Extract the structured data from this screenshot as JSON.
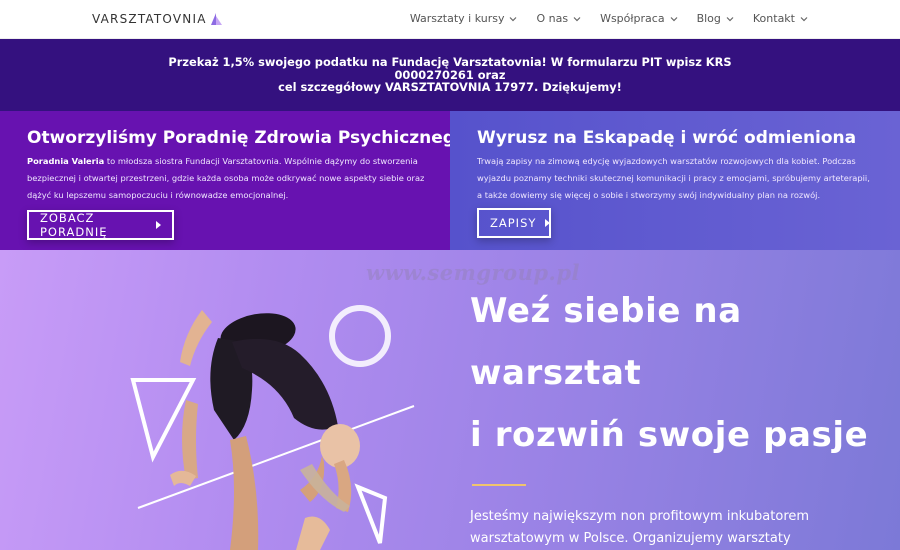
{
  "header": {
    "logo_text": "VARSZTATOVNIA",
    "nav": [
      {
        "label": "Warsztaty i kursy"
      },
      {
        "label": "O nas"
      },
      {
        "label": "Współpraca"
      },
      {
        "label": "Blog"
      },
      {
        "label": "Kontakt"
      }
    ]
  },
  "banner": {
    "line1": "Przekaż 1,5% swojego podatku na Fundację Varsztatovnia! W formularzu PIT wpisz KRS 0000270261 oraz",
    "line2": "cel szczegółowy VARSZTATOVNIA 17977. Dziękujemy!"
  },
  "promo_left": {
    "title": "Otworzyliśmy Poradnię Zdrowia Psychicznego!",
    "text_bold": "Poradnia Valeria",
    "text": " to młodsza siostra Fundacji Varsztatovnia. Wspólnie dążymy do stworzenia bezpiecznej i otwartej przestrzeni, gdzie każda osoba może odkrywać nowe aspekty siebie oraz dążyć ku lepszemu samopoczuciu i równowadze emocjonalnej.",
    "button": "ZOBACZ PORADNIĘ"
  },
  "promo_right": {
    "title": "Wyrusz na Eskapadę i wróć odmieniona",
    "text": "Trwają zapisy na zimową edycję wyjazdowych warsztatów rozwojowych dla kobiet. Podczas wyjazdu poznamy techniki skutecznej komunikacji i pracy z emocjami, spróbujemy arteterapii, a także dowiemy się więcej o sobie i stworzymy swój indywidualny plan na rozwój.",
    "button": "ZAPISY"
  },
  "hero": {
    "watermark": "www.semgroup.pl",
    "title_lines": [
      "Weź siebie na",
      "warsztat",
      "i rozwiń swoje pasje"
    ],
    "text": "Jesteśmy największym non profitowym inkubatorem warsztatowym w Polsce. Organizujemy warsztaty"
  },
  "colors": {
    "banner_bg": "#34117f",
    "promo_left_bg": "#6712b0",
    "promo_right_bg": "#5f5ad0",
    "accent_line": "#f0c46d"
  }
}
